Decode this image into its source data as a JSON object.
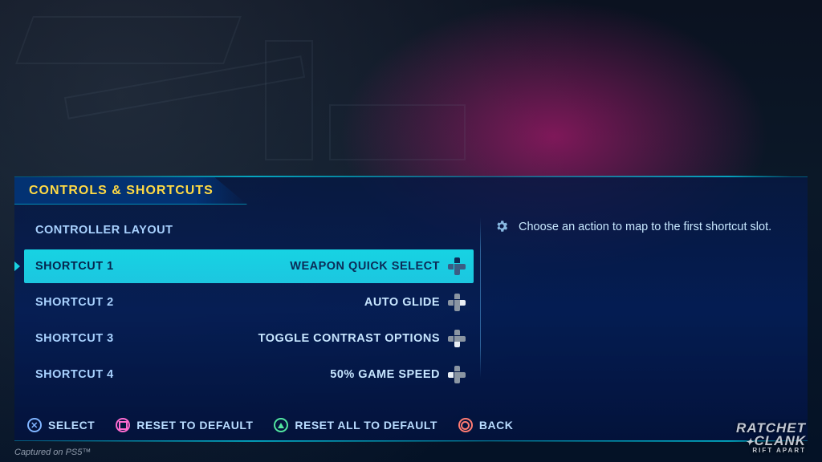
{
  "title": "CONTROLS & SHORTCUTS",
  "items": [
    {
      "label": "CONTROLLER LAYOUT",
      "value": "",
      "dpad": "",
      "selected": false
    },
    {
      "label": "SHORTCUT 1",
      "value": "WEAPON QUICK SELECT",
      "dpad": "up",
      "selected": true
    },
    {
      "label": "SHORTCUT 2",
      "value": "AUTO GLIDE",
      "dpad": "right",
      "selected": false
    },
    {
      "label": "SHORTCUT 3",
      "value": "TOGGLE CONTRAST OPTIONS",
      "dpad": "down",
      "selected": false
    },
    {
      "label": "SHORTCUT 4",
      "value": "50% GAME SPEED",
      "dpad": "left",
      "selected": false
    }
  ],
  "description": "Choose an action to map to the first shortcut slot.",
  "hints": {
    "select": "SELECT",
    "reset": "RESET TO DEFAULT",
    "resetAll": "RESET ALL TO DEFAULT",
    "back": "BACK"
  },
  "capture": "Captured on PS5™",
  "logo": {
    "line1": "RATCHET",
    "line2": "CLANK",
    "line3": "RIFT APART"
  }
}
